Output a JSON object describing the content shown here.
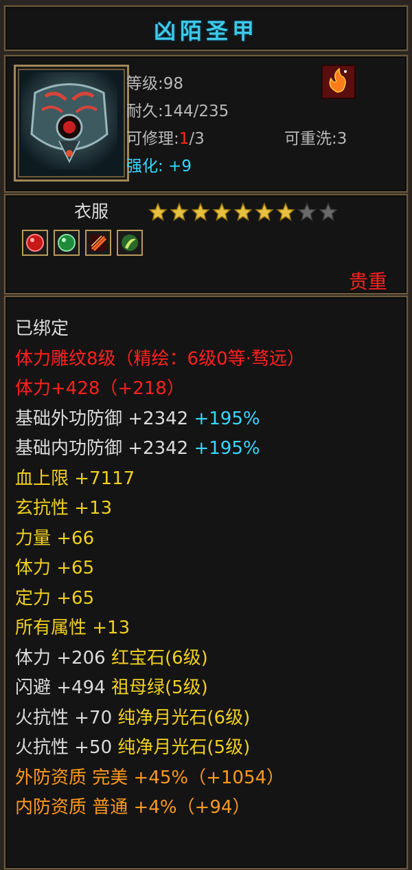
{
  "title": "凶陌圣甲",
  "stats": {
    "level_label": "等级:",
    "level_value": "98",
    "durability_label": "耐久:",
    "durability_value": "144/235",
    "repair_label": "可修理:",
    "repair_current": "1",
    "repair_total": "/3",
    "reforge_label": "可重洗:",
    "reforge_value": "3",
    "enhance_label": "强化:",
    "enhance_value": " +9"
  },
  "slot": "衣服",
  "stars": {
    "filled": 7,
    "total": 9,
    "filled_color": "#e8c040",
    "empty_color": "#6a6a6a"
  },
  "gems": [
    "red-gem-icon",
    "green-gem-icon",
    "fire-gem-icon",
    "moon-gem-icon"
  ],
  "rarity": "贵重",
  "attributes": [
    {
      "text": "已绑定",
      "color": "white"
    },
    {
      "text": "体力雕纹8级（精绘：6级0等·骛远）",
      "color": "red"
    },
    {
      "text": "体力+428（+218）",
      "color": "red"
    },
    {
      "text": "基础外功防御 +2342",
      "extra": " +195%",
      "color": "white"
    },
    {
      "text": "基础内功防御 +2342",
      "extra": " +195%",
      "color": "white"
    },
    {
      "text": "血上限 +7117",
      "color": "yellow"
    },
    {
      "text": "玄抗性 +13",
      "color": "yellow"
    },
    {
      "text": "力量 +66",
      "color": "yellow"
    },
    {
      "text": "体力 +65",
      "color": "yellow"
    },
    {
      "text": "定力 +65",
      "color": "yellow"
    },
    {
      "text": "所有属性 +13",
      "color": "yellow"
    },
    {
      "text": "体力 +206",
      "extra": " 红宝石(6级)",
      "color": "white"
    },
    {
      "text": "闪避 +494",
      "extra": " 祖母绿(5级)",
      "color": "white"
    },
    {
      "text": "火抗性 +70",
      "extra": " 纯净月光石(6级)",
      "color": "white"
    },
    {
      "text": "火抗性 +50",
      "extra": " 纯净月光石(5级)",
      "color": "white"
    },
    {
      "text": "外防资质  完美 +45%（+1054）",
      "color": "orange"
    },
    {
      "text": "内防资质  普通 +4%（+94）",
      "color": "orange"
    }
  ],
  "colors": {
    "title": "#3fc8e8",
    "red": "#ff2020",
    "yellow": "#f0d020",
    "cyan": "#38d8ff",
    "orange": "#ff9a1e",
    "white": "#dcdcdc"
  }
}
